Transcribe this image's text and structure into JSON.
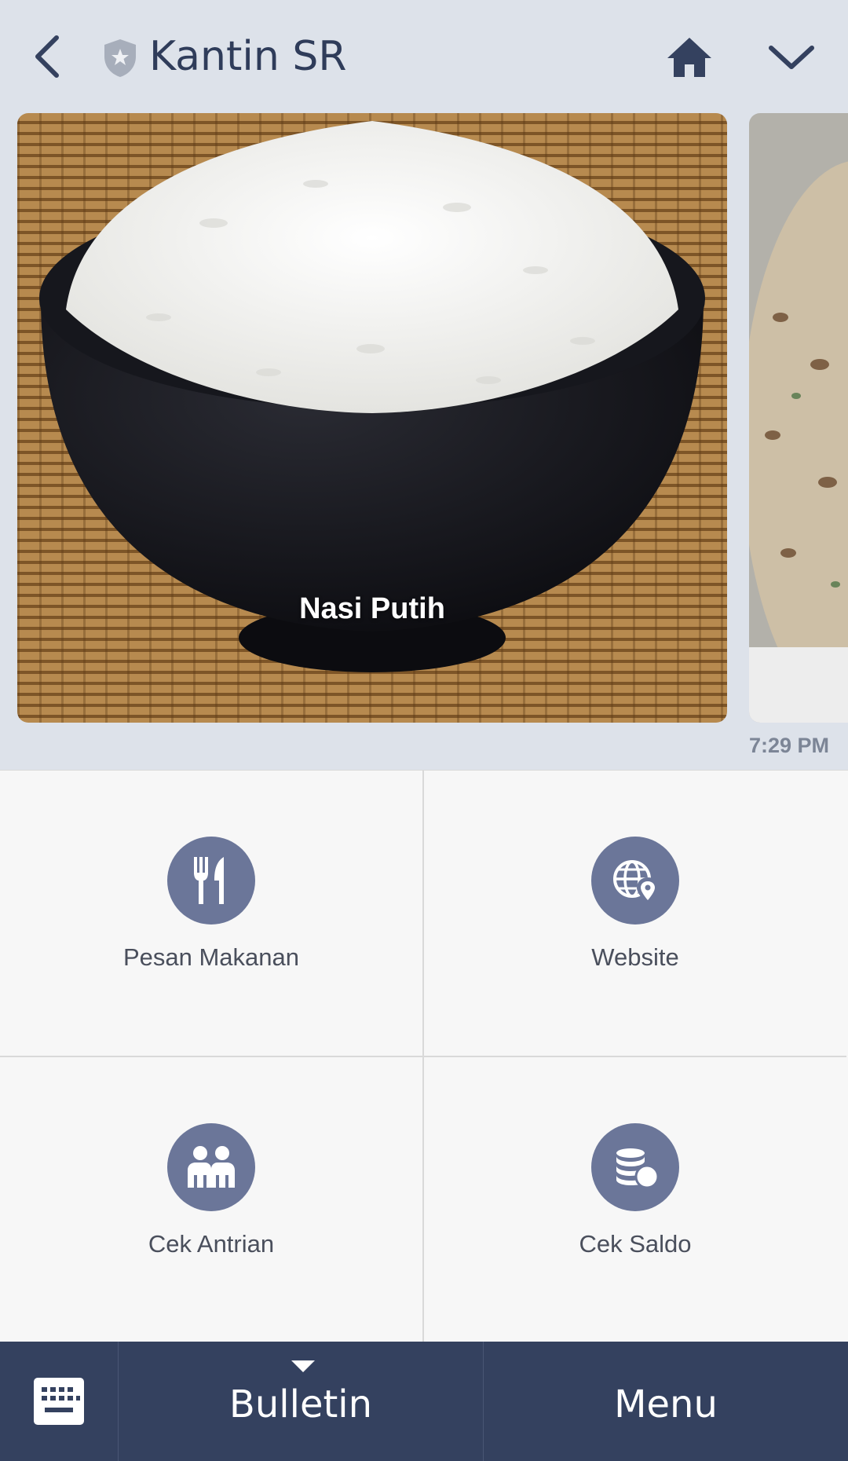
{
  "header": {
    "title": "Kantin SR",
    "back_icon": "chevron-left-icon",
    "shield_icon": "shield-star-icon",
    "home_icon": "home-icon",
    "collapse_icon": "chevron-down-icon"
  },
  "carousel": {
    "items": [
      {
        "label": "Nasi Putih"
      }
    ],
    "timestamp": "7:29 PM"
  },
  "rich_menu": {
    "items": [
      {
        "label": "Pesan Makanan",
        "icon": "fork-knife-icon"
      },
      {
        "label": "Website",
        "icon": "globe-pin-icon"
      },
      {
        "label": "Cek Antrian",
        "icon": "people-icon"
      },
      {
        "label": "Cek Saldo",
        "icon": "coins-icon"
      }
    ]
  },
  "bottom_bar": {
    "keyboard_icon": "keyboard-icon",
    "bulletin_label": "Bulletin",
    "menu_label": "Menu"
  },
  "colors": {
    "header_bg": "#dde2ea",
    "title": "#2f3c5a",
    "icon_circle": "#6b7699",
    "bottom_bar": "#34415f"
  }
}
